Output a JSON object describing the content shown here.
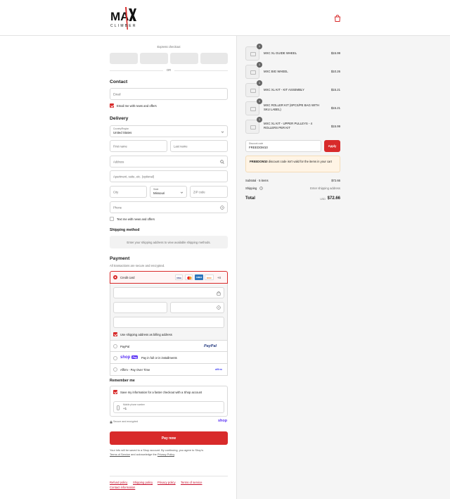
{
  "header": {
    "logo_text": "MAXI CLIMBER",
    "cart_icon": "shopping-bag-icon"
  },
  "express": {
    "label": "Express checkout",
    "or": "OR"
  },
  "contact": {
    "title": "Contact",
    "email_placeholder": "Email",
    "news_label": "Email me with news and offers",
    "news_checked": true
  },
  "delivery": {
    "title": "Delivery",
    "country_label": "Country/Region",
    "country_value": "United States",
    "first_name": "First name",
    "last_name": "Last name",
    "address": "Address",
    "apartment": "Apartment, suite, etc. (optional)",
    "city": "City",
    "state_label": "State",
    "state_value": "Missouri",
    "zip": "ZIP code",
    "phone": "Phone",
    "text_label": "Text me with news and offers"
  },
  "shipping": {
    "title": "Shipping method",
    "notice": "Enter your shipping address to view available shipping methods."
  },
  "payment": {
    "title": "Payment",
    "subtitle": "All transactions are secure and encrypted.",
    "credit_card": "Credit card",
    "more_cards": "+4",
    "cards": [
      "VISA",
      "MC",
      "AMEX",
      "DISC"
    ],
    "billing_label": "Use shipping address as billing address",
    "paypal": "PayPal",
    "paypal_logo": "PayPal",
    "shop_pay": "shop",
    "shop_pay_badge": "Pay",
    "shop_pay_text": "Pay in full or in installments",
    "affirm": "Affirm - Pay Over Time",
    "affirm_logo": "affirm"
  },
  "remember": {
    "title": "Remember me",
    "save_label": "Save my information for a faster checkout with a Shop account",
    "mobile_label": "Mobile phone number",
    "mobile_value": "+1",
    "secure": "Secure and encrypted",
    "shop_logo": "shop"
  },
  "pay_now": "Pay now",
  "disclaimer": {
    "line1": "Your info will be saved to a Shop account. By continuing, you agree to Shop's",
    "terms": "Terms of Service",
    "mid": "and acknowledge the",
    "privacy": "Privacy Policy",
    "end": "."
  },
  "footer": [
    "Refund policy",
    "Shipping policy",
    "Privacy policy",
    "Terms of service",
    "Contact information"
  ],
  "order": {
    "items": [
      {
        "name": "MXC XL GUIDE WHEEL",
        "price": "$15.99",
        "qty": "1"
      },
      {
        "name": "MXC BIG WHEEL",
        "price": "$10.26",
        "qty": "1"
      },
      {
        "name": "MXC XL KIT - KIT ASSEMBLY",
        "price": "$15.21",
        "qty": "1"
      },
      {
        "name": "MXC ROLLER KIT (6PCS/PE BAG WITH SKU LABEL)",
        "price": "$15.21",
        "qty": "1"
      },
      {
        "name": "MXC XL KIT - UPPER PULLEYS - 4 ROLLERS PER KIT",
        "price": "$15.99",
        "qty": "1"
      }
    ],
    "discount_label": "Discount code",
    "discount_value": "FREEDOM10",
    "apply": "Apply",
    "warning_code": "FREEDOM10",
    "warning_text": " discount code isn't valid for the items in your cart",
    "subtotal_label": "Subtotal · 5 items",
    "subtotal_value": "$72.66",
    "shipping_label": "Shipping",
    "shipping_value": "Enter shipping address",
    "total_label": "Total",
    "currency": "USD",
    "total_value": "$72.66"
  },
  "colors": {
    "accent": "#d82a2a",
    "warning_bg": "#fff4e5"
  }
}
